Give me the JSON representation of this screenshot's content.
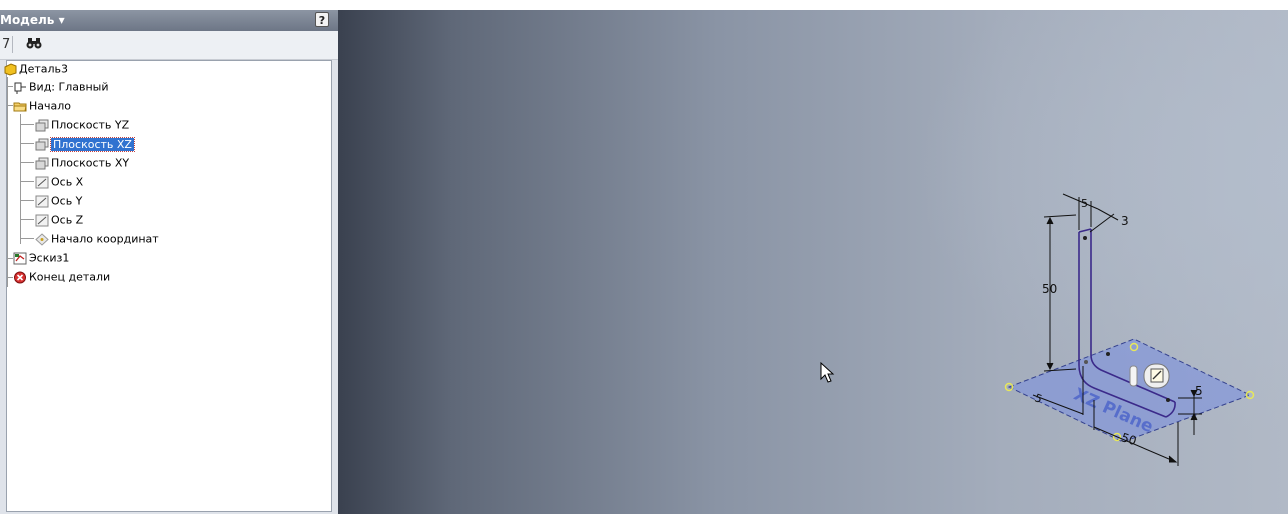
{
  "browser": {
    "title": "Модель ▾",
    "help_label": "?",
    "filter_icon": "filter-icon",
    "find_icon": "binoculars-icon"
  },
  "tree": {
    "root": "Деталь3",
    "view": "Вид: Главный",
    "origin": "Начало",
    "plane_yz": "Плоскость YZ",
    "plane_xz": "Плоскость XZ",
    "plane_xy": "Плоскость XY",
    "axis_x": "Ось X",
    "axis_y": "Ось Y",
    "axis_z": "Ось Z",
    "origin_point": "Начало координат",
    "sketch": "Эскиз1",
    "end": "Конец детали",
    "selected": "Плоскость XZ"
  },
  "viewport": {
    "dimensions": {
      "thickness_top": "5",
      "offset_top": "3",
      "height": "50",
      "thickness_left": "5",
      "thickness_right": "5",
      "length": "50"
    },
    "plane_label": "XZ Plane",
    "colors": {
      "sketch_line": "#3b2a8a",
      "plane_fill": "#6f86d8",
      "endpoint": "#e8e85a"
    }
  }
}
